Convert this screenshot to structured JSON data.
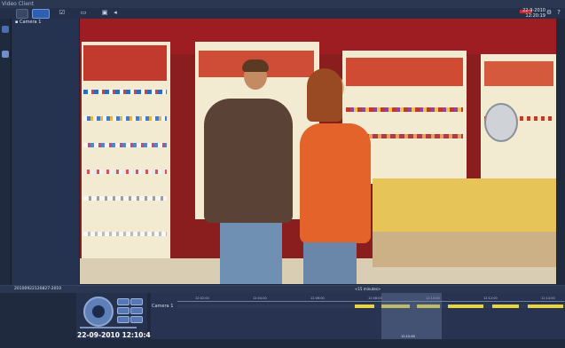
{
  "window": {
    "title": "Video Client"
  },
  "toolbar": {
    "icons": [
      "layout-1x1-icon",
      "layout-grid-icon",
      "checkbox-icon",
      "bookmark-icon",
      "export-icon",
      "volume-icon"
    ],
    "clock_date": "22-9-2010",
    "clock_time": "12:20:19"
  },
  "camera_panel": {
    "item": "Camera 1"
  },
  "playback": {
    "file_label": "20100922120827-2010",
    "date_time": "22-09-2010 12:10:48"
  },
  "timeline": {
    "camera_label": "Camera 1",
    "zoom_label": "<15 minutes>",
    "ticks": [
      "12:02:00",
      "12:04:00",
      "12:06:00",
      "12:08:00",
      "12:10:00",
      "12:12:00",
      "12:14:00"
    ],
    "cursor_label": "12:10:48"
  },
  "colors": {
    "accent": "#2f5fb0",
    "recording": "#e7d63c",
    "alarm": "#d22b2b"
  }
}
